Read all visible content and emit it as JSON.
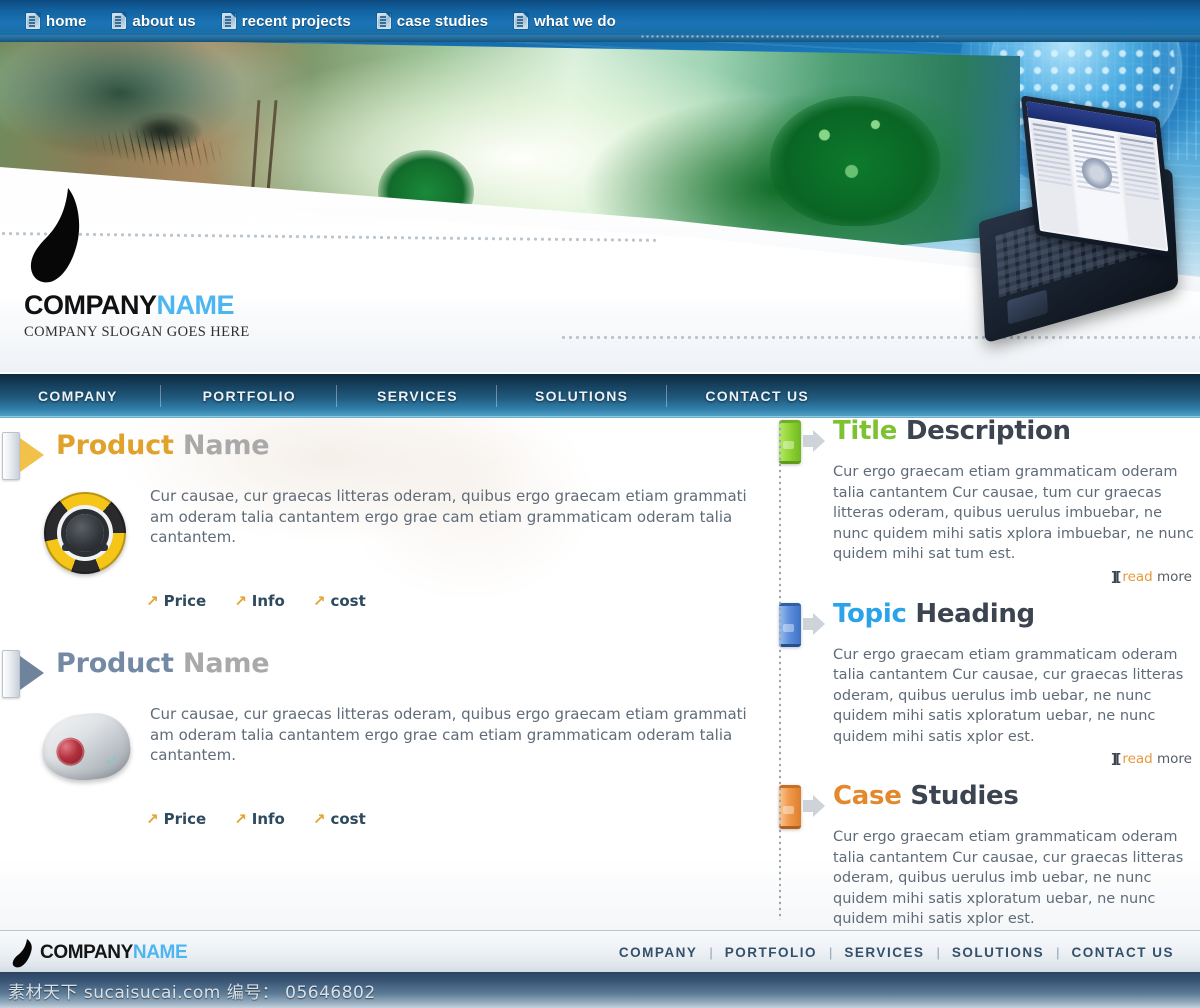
{
  "topnav": {
    "items": [
      {
        "icon": "document-icon",
        "label": "home"
      },
      {
        "icon": "document-icon",
        "label": "about us"
      },
      {
        "icon": "document-icon",
        "label": "recent projects"
      },
      {
        "icon": "document-icon",
        "label": "case studies"
      },
      {
        "icon": "document-icon",
        "label": "what we do"
      }
    ]
  },
  "logo": {
    "name_first": "COMPANY",
    "name_second": "NAME",
    "slogan": "COMPANY SLOGAN GOES HERE",
    "accent_color": "#4db6f0"
  },
  "mainnav": {
    "items": [
      "COMPANY",
      "PORTFOLIO",
      "SERVICES",
      "SOLUTIONS",
      "CONTACT US"
    ]
  },
  "products": [
    {
      "title_first": "Product",
      "title_second": "Name",
      "accent_color": "#e0a22b",
      "image": "steering-wheel-icon",
      "body": "Cur causae, cur graecas litteras oderam, quibus ergo graecam etiam grammati am oderam talia cantantem ergo grae cam etiam grammaticam oderam talia cantantem.",
      "links": [
        "Price",
        "Info",
        "cost"
      ]
    },
    {
      "title_first": "Product",
      "title_second": "Name",
      "accent_color": "#748aa4",
      "image": "trackball-mouse-icon",
      "body": "Cur causae, cur graecas litteras oderam, quibus ergo graecam etiam grammati am oderam talia cantantem ergo grae cam etiam grammaticam oderam talia cantantem.",
      "links": [
        "Price",
        "Info",
        "cost"
      ]
    }
  ],
  "topics": [
    {
      "title_first": "Title",
      "title_second": "Description",
      "accent_color": "#7ec232",
      "pill_color": "green",
      "body": "Cur ergo graecam etiam grammaticam oderam talia cantantem Cur causae, tum cur graecas litteras oderam, quibus uerulus imbuebar, ne nunc quidem mihi satis xplora imbuebar, ne nunc quidem mihi sat tum est.",
      "read_label": "read",
      "more_label": "more"
    },
    {
      "title_first": "Topic",
      "title_second": "Heading",
      "accent_color": "#2aa3e8",
      "pill_color": "blue",
      "body": "Cur ergo graecam etiam grammaticam oderam talia cantantem Cur causae, cur graecas litteras oderam, quibus uerulus imb uebar, ne nunc quidem mihi satis xploratum uebar, ne nunc quidem mihi satis xplor est.",
      "read_label": "read",
      "more_label": "more"
    },
    {
      "title_first": "Case",
      "title_second": "Studies",
      "accent_color": "#e3882c",
      "pill_color": "orange",
      "body": "Cur ergo graecam etiam grammaticam oderam talia cantantem Cur causae, cur graecas litteras oderam, quibus uerulus imb uebar, ne nunc quidem mihi satis xploratum uebar, ne nunc quidem mihi satis xplor est.",
      "read_label": "read",
      "more_label": "more"
    }
  ],
  "footer": {
    "logo_first": "COMPANY",
    "logo_second": "NAME",
    "nav": [
      "COMPANY",
      "PORTFOLIO",
      "SERVICES",
      "SOLUTIONS",
      "CONTACT US"
    ],
    "separator": "|"
  },
  "watermark": {
    "text": "素材天下 sucaisucai.com  编号： 05646802"
  }
}
